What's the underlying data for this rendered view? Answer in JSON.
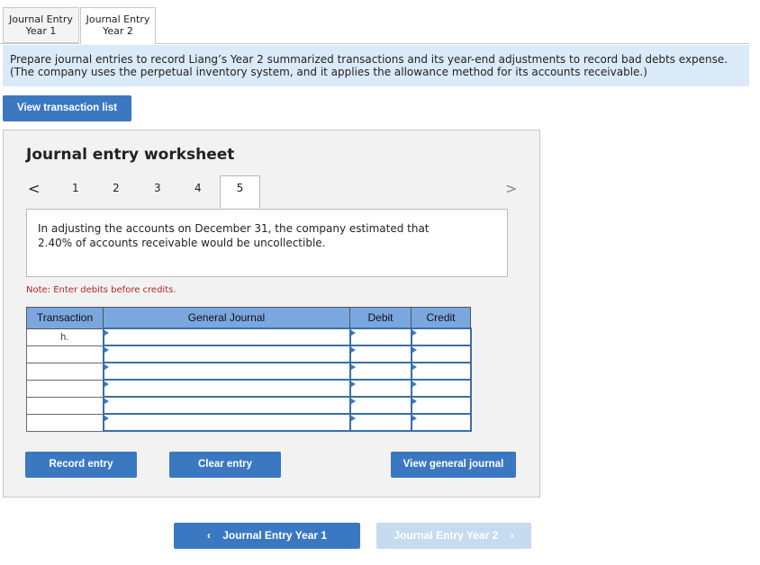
{
  "tabs": [
    {
      "line1": "Journal Entry",
      "line2": "Year 1"
    },
    {
      "line1": "Journal Entry",
      "line2": "Year 2"
    }
  ],
  "instructions": {
    "line1": "Prepare journal entries to record Liang’s Year 2 summarized transactions and its year-end adjustments to record bad debts expense.",
    "line2": "(The company uses the perpetual inventory system, and it applies the allowance method for its accounts receivable.)"
  },
  "view_transaction_list": "View transaction list",
  "worksheet": {
    "title": "Journal entry worksheet",
    "prev_arrow": "<",
    "next_arrow": ">",
    "pages": [
      "1",
      "2",
      "3",
      "4",
      "5"
    ],
    "active_page": "5",
    "description_line1": "In adjusting the accounts on December 31, the company estimated that",
    "description_line2": "2.40% of accounts receivable would be uncollectible.",
    "note": "Note: Enter debits before credits.",
    "table": {
      "headers": [
        "Transaction",
        "General Journal",
        "Debit",
        "Credit"
      ],
      "rows": [
        {
          "transaction": "h."
        },
        {
          "transaction": ""
        },
        {
          "transaction": ""
        },
        {
          "transaction": ""
        },
        {
          "transaction": ""
        },
        {
          "transaction": ""
        }
      ]
    },
    "record_entry": "Record entry",
    "clear_entry": "Clear entry",
    "view_general_journal": "View general journal"
  },
  "footer": {
    "prev_label": "Journal Entry Year 1",
    "prev_icon": "chevron-left-icon",
    "next_label": "Journal Entry Year 2",
    "next_icon": "chevron-right-icon"
  },
  "colors": {
    "accent": "#3b78c2",
    "instruction_bg": "#dbeaf9",
    "table_header": "#7ba7e0",
    "note_text": "#b12727",
    "disabled_button": "#c7dbf0"
  }
}
